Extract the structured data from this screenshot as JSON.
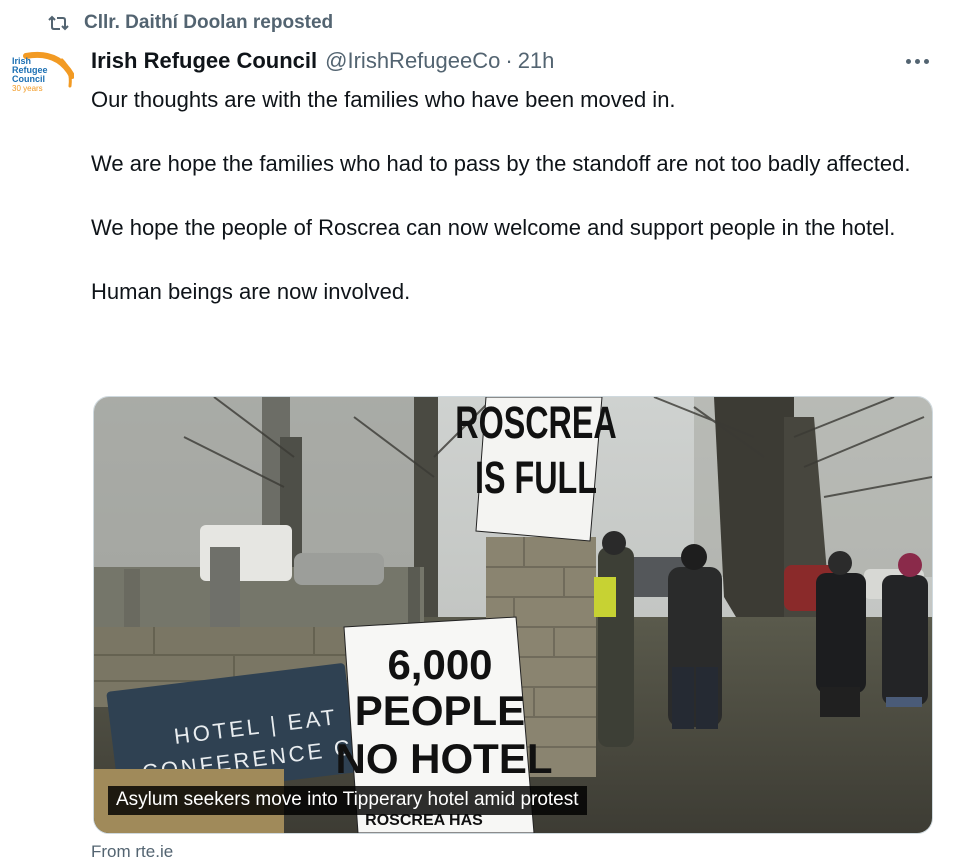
{
  "repost": {
    "label": "Cllr. Daithí Doolan reposted",
    "icon": "repost-icon"
  },
  "tweet": {
    "author": "Irish Refugee Council",
    "handle": "@IrishRefugeeCo",
    "separator": "·",
    "time": "21h",
    "paragraphs": [
      "Our thoughts are with the families who have been moved in.",
      "We are hope the families who had to pass by the standoff are not too badly affected.",
      "We hope the people of Roscrea can now welcome and support people in the hotel.",
      "Human beings are now involved."
    ]
  },
  "avatar": {
    "logo_text": [
      "Irish",
      "Refugee",
      "Council"
    ],
    "logo_sub": "30 years",
    "colors": {
      "blue": "#1b6fb3",
      "orange": "#f29a23"
    }
  },
  "media": {
    "caption": "Asylum seekers move into Tipperary hotel amid protest",
    "sign_top": [
      "ROSCREA",
      "IS FULL"
    ],
    "sign_bottom": [
      "6,000",
      "PEOPLE",
      "NO HOTEL"
    ],
    "sign_bottom_footer": "ROSCREA HAS",
    "hotel_sign": [
      "HOTEL | EAT",
      "CONFERENCE C"
    ]
  },
  "link_source": "From rte.ie",
  "colors": {
    "text": "#0f1419",
    "secondary": "#536471",
    "border": "#cfd9de"
  }
}
